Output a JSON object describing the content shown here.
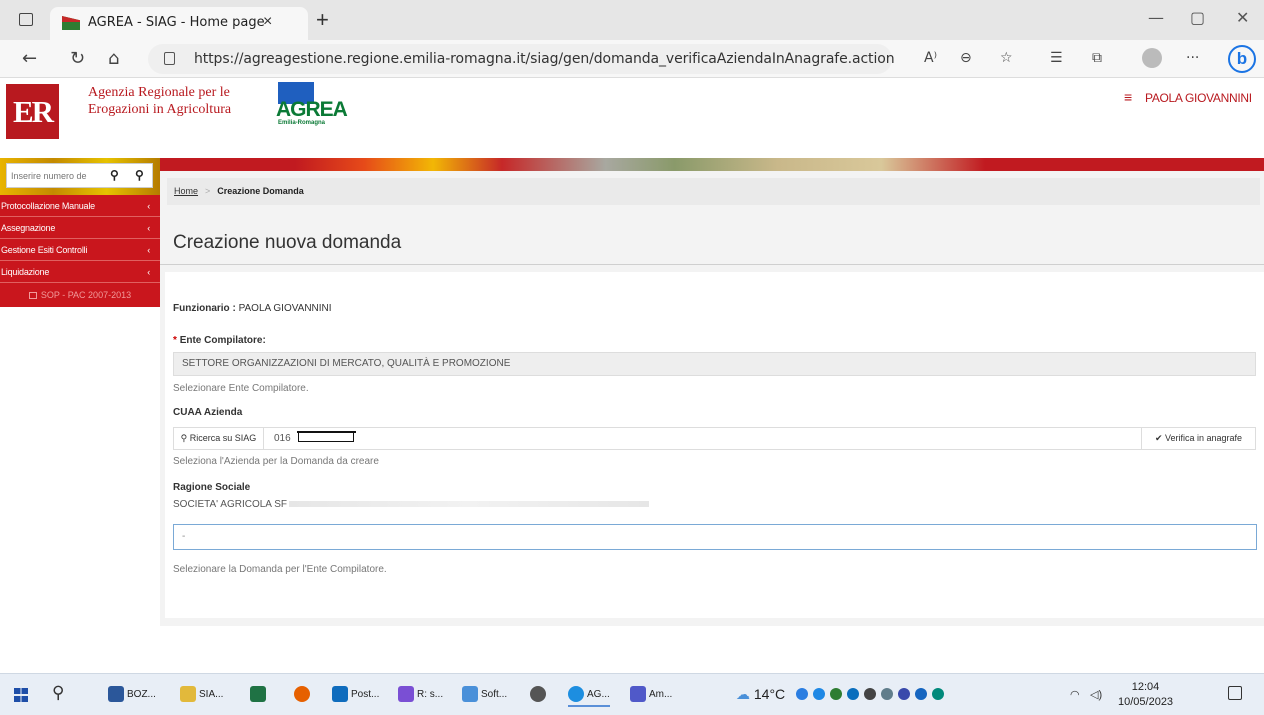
{
  "browser": {
    "tab_title": "AGREA - SIAG - Home page",
    "tab_close": "×",
    "new_tab": "+",
    "url": "https://agreagestione.regione.emilia-romagna.it/siag/gen/domanda_verificaAziendaInAnagrafe.action",
    "read_aloud": "A⁾",
    "more": "···",
    "bing": "b"
  },
  "header": {
    "logo_er": "ER",
    "agency_line1": "Agenzia Regionale per le",
    "agency_line2": "Erogazioni in Agricoltura",
    "agrea_word": "AGREA",
    "agrea_sub": "Emilia-Romagna",
    "menu_icon": "≡",
    "user_name": "PAOLA GIOVANNINI"
  },
  "sidebar": {
    "search_placeholder": "Inserire numero de",
    "items": [
      {
        "label": "Protocollazione Manuale"
      },
      {
        "label": "Assegnazione"
      },
      {
        "label": "Gestione Esiti Controlli"
      },
      {
        "label": "Liquidazione"
      }
    ],
    "chevron": "‹",
    "sop_label": "SOP - PAC 2007-2013"
  },
  "breadcrumb": {
    "home": "Home",
    "separator": ">",
    "current": "Creazione Domanda"
  },
  "page_title": "Creazione nuova domanda",
  "form": {
    "funzionario_label": "Funzionario :",
    "funzionario_value": "PAOLA  GIOVANNINI",
    "required_mark": "*",
    "ente_label": "Ente Compilatore:",
    "ente_value": "SETTORE ORGANIZZAZIONI DI MERCATO, QUALITÀ E PROMOZIONE",
    "ente_help": "Selezionare Ente Compilatore.",
    "cuaa_label": "CUAA Azienda",
    "ricerca_button": "Ricerca su SIAG",
    "cuaa_value": "016",
    "verifica_button": "Verifica in anagrafe",
    "cuaa_help": "Seleziona l'Azienda per la Domanda da creare",
    "ragione_label": "Ragione Sociale",
    "ragione_value": "SOCIETA' AGRICOLA SF",
    "domanda_value": "-",
    "domanda_help": "Selezionare la Domanda per l'Ente Compilatore."
  },
  "taskbar": {
    "apps": [
      {
        "label": "BOZ...",
        "color": "#2b579a"
      },
      {
        "label": "SIA...",
        "color": "#e2b93b"
      },
      {
        "label": "",
        "color": "#1f7244"
      },
      {
        "label": "",
        "color": "#e66000"
      },
      {
        "label": "Post...",
        "color": "#0f6cbd"
      },
      {
        "label": "R: s...",
        "color": "#7a4fd4"
      },
      {
        "label": "Soft...",
        "color": "#4a90d9"
      },
      {
        "label": "",
        "color": "#555555"
      },
      {
        "label": "AG...",
        "color": "#1d8ee0"
      },
      {
        "label": "Am...",
        "color": "#5059c9"
      }
    ],
    "weather": "14°C",
    "time": "12:04",
    "date": "10/05/2023"
  }
}
